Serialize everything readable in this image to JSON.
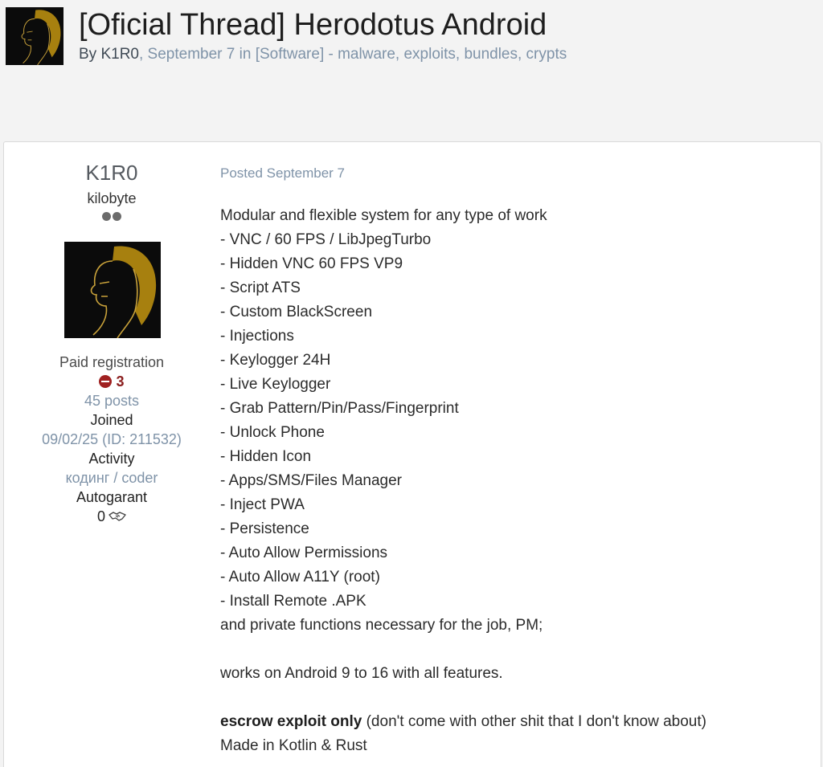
{
  "topic": {
    "title": "[Oficial Thread] Herodotus Android",
    "by_prefix": "By",
    "author": "K1R0",
    "date_text": ", September 7 in ",
    "forum": "[Software] - malware, exploits, bundles, crypts"
  },
  "author_panel": {
    "name": "K1R0",
    "rank": "kilobyte",
    "group": "Paid registration",
    "warning_points": "3",
    "posts": "45 posts",
    "joined_label": "Joined",
    "joined_value": "09/02/25 (ID: 211532)",
    "activity_label": "Activity",
    "activity_value": "кодинг / coder",
    "autogarant_label": "Autogarant",
    "autogarant_value": "0"
  },
  "post": {
    "posted_label": "Posted September 7",
    "intro": "Modular and flexible system for any type of work",
    "features": [
      "- VNC / 60 FPS / LibJpegTurbo",
      "- Hidden VNC 60 FPS VP9",
      "- Script ATS",
      "- Custom BlackScreen",
      "- Injections",
      "- Keylogger 24H",
      "- Live Keylogger",
      "- Grab Pattern/Pin/Pass/Fingerprint",
      "- Unlock Phone",
      "- Hidden Icon",
      "- Apps/SMS/Files Manager",
      "- Inject PWA",
      "- Persistence",
      "- Auto Allow Permissions",
      "- Auto Allow A11Y (root)",
      "- Install Remote .APK"
    ],
    "private_functions": "and private functions necessary for the job, PM;",
    "compat": "works on Android 9 to 16 with all features.",
    "escrow_bold": "escrow exploit only",
    "escrow_rest": " (don't come with other shit that I don't know about)",
    "made_in": "Made in Kotlin & Rust"
  },
  "icons": {
    "avatar": "avatar-portrait-icon",
    "warning": "minus-circle-icon",
    "handshake": "handshake-icon"
  },
  "colors": {
    "link_muted": "#7f93a8",
    "warning": "#a02121",
    "avatar_gold": "#b08416"
  }
}
